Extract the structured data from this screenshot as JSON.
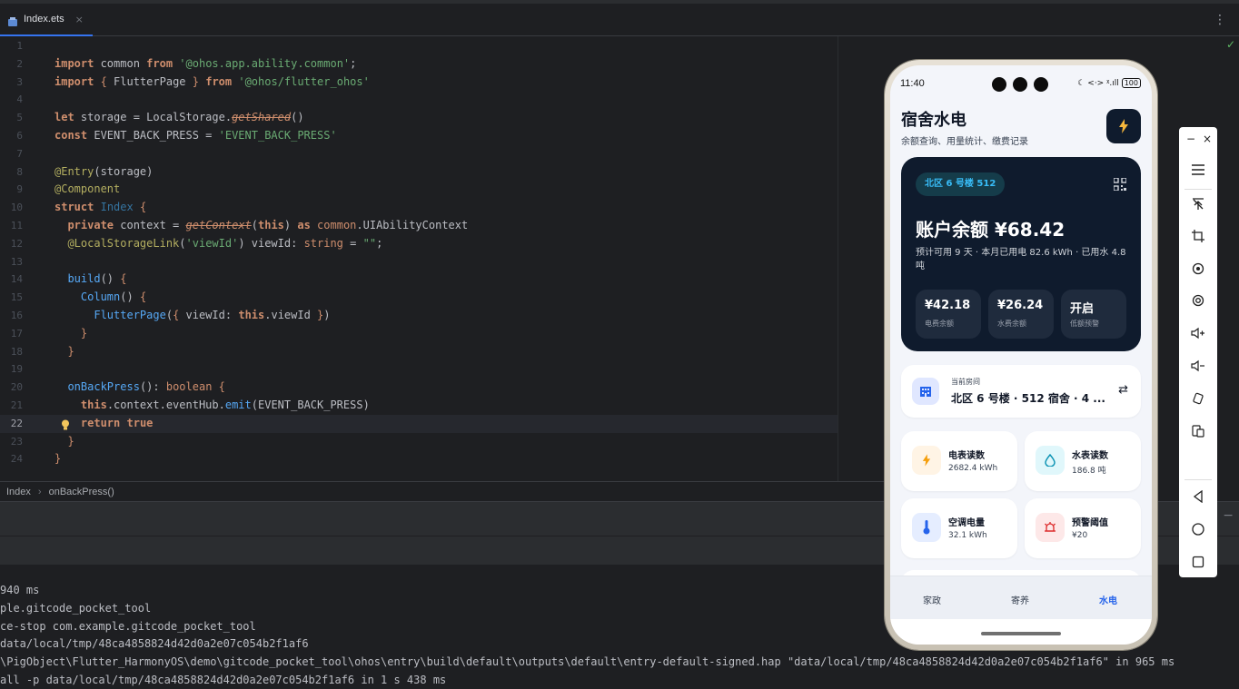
{
  "ide": {
    "tab_label": "Index.ets",
    "tab_close": "×",
    "kebab": "⋮",
    "check": "✓",
    "breadcrumb": [
      "Index",
      "onBackPress()"
    ],
    "breadcrumb_sep": "›"
  },
  "code_lines": [
    {
      "n": "1",
      "html": ""
    },
    {
      "n": "2",
      "html": "<span class='kwb'>import</span> common <span class='kwb'>from</span> <span class='str'>'@ohos.app.ability.common'</span>;"
    },
    {
      "n": "3",
      "html": "<span class='kwb'>import</span> <span class='kw'>{</span> FlutterPage <span class='kw'>}</span> <span class='kwb'>from</span> <span class='str'>'@ohos/flutter_ohos'</span>"
    },
    {
      "n": "4",
      "html": ""
    },
    {
      "n": "5",
      "html": "<span class='kwb'>let</span> storage = LocalStorage.<span class='strike'>getShared</span>()"
    },
    {
      "n": "6",
      "html": "<span class='kwb'>const</span> EVENT_BACK_PRESS = <span class='str'>'EVENT_BACK_PRESS'</span>"
    },
    {
      "n": "7",
      "html": ""
    },
    {
      "n": "8",
      "html": "<span class='dec'>@Entry</span>(storage)"
    },
    {
      "n": "9",
      "html": "<span class='dec'>@Component</span>"
    },
    {
      "n": "10",
      "html": "<span class='kwb'>struct</span> <span class='cls'>Index</span> <span class='kw'>{</span>"
    },
    {
      "n": "11",
      "html": "  <span class='kwb'>private</span> context = <span class='strike'>getContext</span>(<span class='kwb'>this</span>) <span class='kwb'>as</span> <span class='kw'>common</span>.UIAbilityContext"
    },
    {
      "n": "12",
      "html": "  <span class='dec'>@LocalStorageLink</span>(<span class='str'>'viewId'</span>) viewId: <span class='kw'>string</span> = <span class='str'>\"\"</span>;"
    },
    {
      "n": "13",
      "html": ""
    },
    {
      "n": "14",
      "html": "  <span class='fn'>build</span>() <span class='kw'>{</span>"
    },
    {
      "n": "15",
      "html": "    <span class='fn'>Column</span>() <span class='kw'>{</span>"
    },
    {
      "n": "16",
      "html": "      <span class='fn'>FlutterPage</span>(<span class='kw'>{</span> viewId: <span class='kwb'>this</span>.viewId <span class='kw'>}</span>)"
    },
    {
      "n": "17",
      "html": "    <span class='kw'>}</span>"
    },
    {
      "n": "18",
      "html": "  <span class='kw'>}</span>"
    },
    {
      "n": "19",
      "html": ""
    },
    {
      "n": "20",
      "html": "  <span class='fn'>onBackPress</span>(): <span class='kw'>boolean</span> <span class='kw'>{</span>"
    },
    {
      "n": "21",
      "html": "    <span class='kwb'>this</span>.context.eventHub.<span class='fn'>emit</span>(EVENT_BACK_PRESS)"
    },
    {
      "n": "22",
      "html": "    <span class='kwb'>return</span> <span class='kwb'>true</span>",
      "current": true
    },
    {
      "n": "23",
      "html": "  <span class='kw'>}</span>"
    },
    {
      "n": "24",
      "html": "<span class='kw'>}</span>"
    }
  ],
  "console_lines": [
    "940 ms",
    "ple.gitcode_pocket_tool",
    "ce-stop com.example.gitcode_pocket_tool",
    "data/local/tmp/48ca4858824d42d0a2e07c054b2f1af6",
    "\\PigObject\\Flutter_HarmonyOS\\demo\\gitcode_pocket_tool\\ohos\\entry\\build\\default\\outputs\\default\\entry-default-signed.hap \"data/local/tmp/48ca4858824d42d0a2e07c054b2f1af6\" in 965 ms",
    "all -p data/local/tmp/48ca4858824d42d0a2e07c054b2f1af6 in 1 s 438 ms"
  ],
  "phone": {
    "time": "11:40",
    "status_icons": "☾ <·> ᵡ.ıll",
    "battery": "100",
    "title": "宿舍水电",
    "subtitle": "余额查询、用量统计、缴费记录",
    "room_chip": "北区 6 号楼 512",
    "balance_label": "账户余额 ¥68.42",
    "balance_detail": "预计可用 9 天 · 本月已用电 82.6 kWh · 已用水 4.8 吨",
    "minis": [
      {
        "value": "¥42.18",
        "label": "电费余额"
      },
      {
        "value": "¥26.24",
        "label": "水费余额"
      },
      {
        "value": "开启",
        "label": "低额预警"
      }
    ],
    "room_caption": "当前房间",
    "room_name": "北区 6 号楼 · 512 宿舍 · 4 ...",
    "swap": "⇄",
    "tiles": [
      {
        "title": "电表读数",
        "value": "2682.4 kWh",
        "icon": "bolt-icon",
        "bg": "#fff4e5",
        "fg": "#f59e0b"
      },
      {
        "title": "水表读数",
        "value": "186.8 吨",
        "icon": "water-drop-icon",
        "bg": "#e0f7fb",
        "fg": "#0891b2"
      },
      {
        "title": "空调电量",
        "value": "32.1 kWh",
        "icon": "thermometer-icon",
        "bg": "#e5edff",
        "fg": "#2563eb"
      },
      {
        "title": "预警阈值",
        "value": "¥20",
        "icon": "alarm-icon",
        "bg": "#fde8e8",
        "fg": "#dc2626"
      }
    ],
    "nav": [
      {
        "label": "家政",
        "active": false
      },
      {
        "label": "寄养",
        "active": false
      },
      {
        "label": "水电",
        "active": true
      }
    ]
  },
  "emulator_tools": {
    "minimize": "−",
    "close": "×"
  },
  "colors": {
    "accent": "#3574f0",
    "card_dark": "#0f1b2d",
    "nav_active": "#2563eb"
  }
}
